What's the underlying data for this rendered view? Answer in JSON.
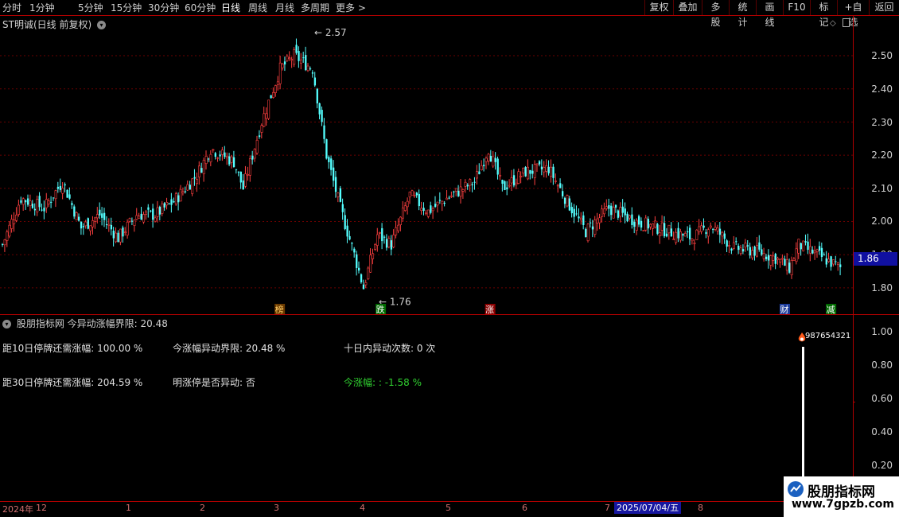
{
  "toolbar": {
    "periods": [
      "分时",
      "1分钟",
      "5分钟",
      "15分钟",
      "30分钟",
      "60分钟",
      "日线",
      "周线",
      "月线",
      "多周期",
      "更多 >"
    ],
    "active_period": "日线",
    "tools": [
      "复权",
      "叠加",
      "多股",
      "统计",
      "画线",
      "F10",
      "标记",
      "+自选",
      "返回"
    ]
  },
  "stock": {
    "title": "ST明诚(日线 前复权)"
  },
  "price_axis": [
    "2.50",
    "2.40",
    "2.30",
    "2.20",
    "2.10",
    "2.00",
    "1.90",
    "1.80"
  ],
  "current_price": "1.86",
  "high_label": "2.57",
  "low_label": "1.76",
  "signals": [
    {
      "text": "榜",
      "color": "#ffcc66",
      "bg": "#6a3a00",
      "x": 0.33
    },
    {
      "text": "跌",
      "color": "#ffffff",
      "bg": "#006a00",
      "x": 0.45
    },
    {
      "text": "涨",
      "color": "#ffffff",
      "bg": "#8a0000",
      "x": 0.58
    },
    {
      "text": "财",
      "color": "#ffffff",
      "bg": "#1a3a9a",
      "x": 0.93
    },
    {
      "text": "减",
      "color": "#ffffff",
      "bg": "#006a00",
      "x": 0.985
    }
  ],
  "indicator": {
    "header": "股朋指标网 今异动涨幅界限: 20.48",
    "row1": [
      "距10日停牌还需涨幅: 100.00 %",
      "今涨幅异动界限: 20.48 %",
      "十日内异动次数: 0 次"
    ],
    "row2": [
      "距30日停牌还需涨幅: 204.59 %",
      "明涨停是否异动: 否",
      "今涨幅: : -1.58 %"
    ],
    "marker": "987654321",
    "axis": [
      "1.00",
      "0.80",
      "0.60",
      "0.40",
      "0.20"
    ]
  },
  "dates": [
    "2024年",
    "12",
    "1",
    "2",
    "3",
    "4",
    "5",
    "6",
    "7",
    "8"
  ],
  "date_selected": "2025/07/04/五",
  "watermark": {
    "line1": "股朋指标网",
    "line2": "www.7gpzb.com"
  },
  "colors": {
    "up": "#ff4040",
    "down": "#54ffff",
    "grid": "#b00000"
  }
}
